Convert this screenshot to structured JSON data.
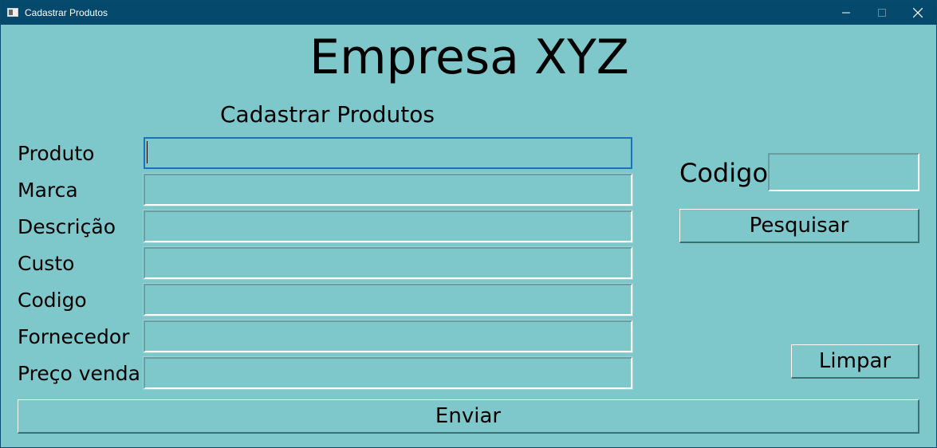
{
  "window": {
    "title": "Cadastrar Produtos",
    "controls": {
      "minimize_icon": "minimize-icon",
      "maximize_icon": "maximize-icon",
      "close_icon": "close-icon"
    }
  },
  "header": {
    "company": "Empresa XYZ",
    "section_title": "Cadastrar Produtos"
  },
  "form": {
    "fields": [
      {
        "label": "Produto",
        "value": "",
        "focused": true
      },
      {
        "label": "Marca",
        "value": ""
      },
      {
        "label": "Descrição",
        "value": ""
      },
      {
        "label": "Custo",
        "value": ""
      },
      {
        "label": "Codigo",
        "value": ""
      },
      {
        "label": "Fornecedor",
        "value": ""
      },
      {
        "label": "Preço venda",
        "value": ""
      }
    ],
    "submit_label": "Enviar"
  },
  "search": {
    "code_label": "Codigo",
    "code_value": "",
    "search_label": "Pesquisar",
    "clear_label": "Limpar"
  },
  "colors": {
    "background": "#7ec8cb",
    "titlebar": "#05496d",
    "focus_border": "#1a73b8"
  }
}
